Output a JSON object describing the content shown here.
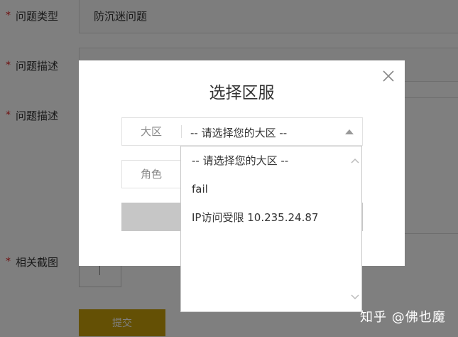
{
  "form": {
    "required_mark": "*",
    "problem_type_label": "问题类型",
    "problem_type_value": "防沉迷问题",
    "problem_desc_label_1": "问题描述",
    "problem_desc_label_2": "问题描述",
    "screenshot_label": "相关截图",
    "submit_label": "提交"
  },
  "modal": {
    "title": "选择区服",
    "region_label": "大区",
    "region_value": "-- 请选择您的大区 --",
    "role_label": "角色"
  },
  "dropdown": {
    "options": [
      "-- 请选择您的大区 --",
      "fail",
      "IP访问受限 10.235.24.87"
    ]
  },
  "watermark": "知乎 @佛也魔",
  "colors": {
    "required": "#e02020",
    "submit": "#c9a00a",
    "overlay": "rgba(0,0,0,0.5)"
  }
}
